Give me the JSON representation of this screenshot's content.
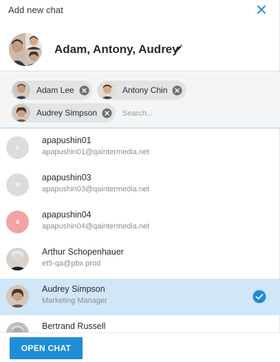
{
  "dialog": {
    "title": "Add new chat"
  },
  "group": {
    "name": "Adam, Antony, Audrey"
  },
  "chips": [
    {
      "label": "Adam Lee"
    },
    {
      "label": "Antony Chin"
    },
    {
      "label": "Audrey Simpson"
    }
  ],
  "search": {
    "placeholder": "Search...",
    "value": ""
  },
  "contacts": [
    {
      "name": "apapushin01",
      "sub": "apapushin01@qaintermedia.net",
      "avatar_letter": "a",
      "avatar_color": "#dcdcdc",
      "selected": false
    },
    {
      "name": "apapushin03",
      "sub": "apapushin03@qaintermedia.net",
      "avatar_letter": "a",
      "avatar_color": "#dcdcdc",
      "selected": false
    },
    {
      "name": "apapushin04",
      "sub": "apapushin04@qaintermedia.net",
      "avatar_letter": "a",
      "avatar_color": "#f2a3a3",
      "selected": false
    },
    {
      "name": "Arthur Schopenhauer",
      "sub": "et5-qa@pbx.prod",
      "avatar_letter": "",
      "avatar_color": "#4a3f37",
      "selected": false
    },
    {
      "name": "Audrey Simpson",
      "sub": "Marketing Manager",
      "avatar_letter": "",
      "avatar_color": "#5b4a42",
      "selected": true
    },
    {
      "name": "Bertrand Russell",
      "sub": "",
      "avatar_letter": "",
      "avatar_color": "#8a8a8a",
      "selected": false
    }
  ],
  "footer": {
    "open_label": "OPEN CHAT"
  },
  "colors": {
    "accent": "#1f8dd6",
    "selected_row": "#cfe7f7",
    "chip_bg": "#e3e4e6"
  },
  "icons": {
    "close": "close-icon",
    "edit": "pencil-icon",
    "chip_remove": "remove-circle-icon",
    "selected": "check-circle-icon"
  }
}
